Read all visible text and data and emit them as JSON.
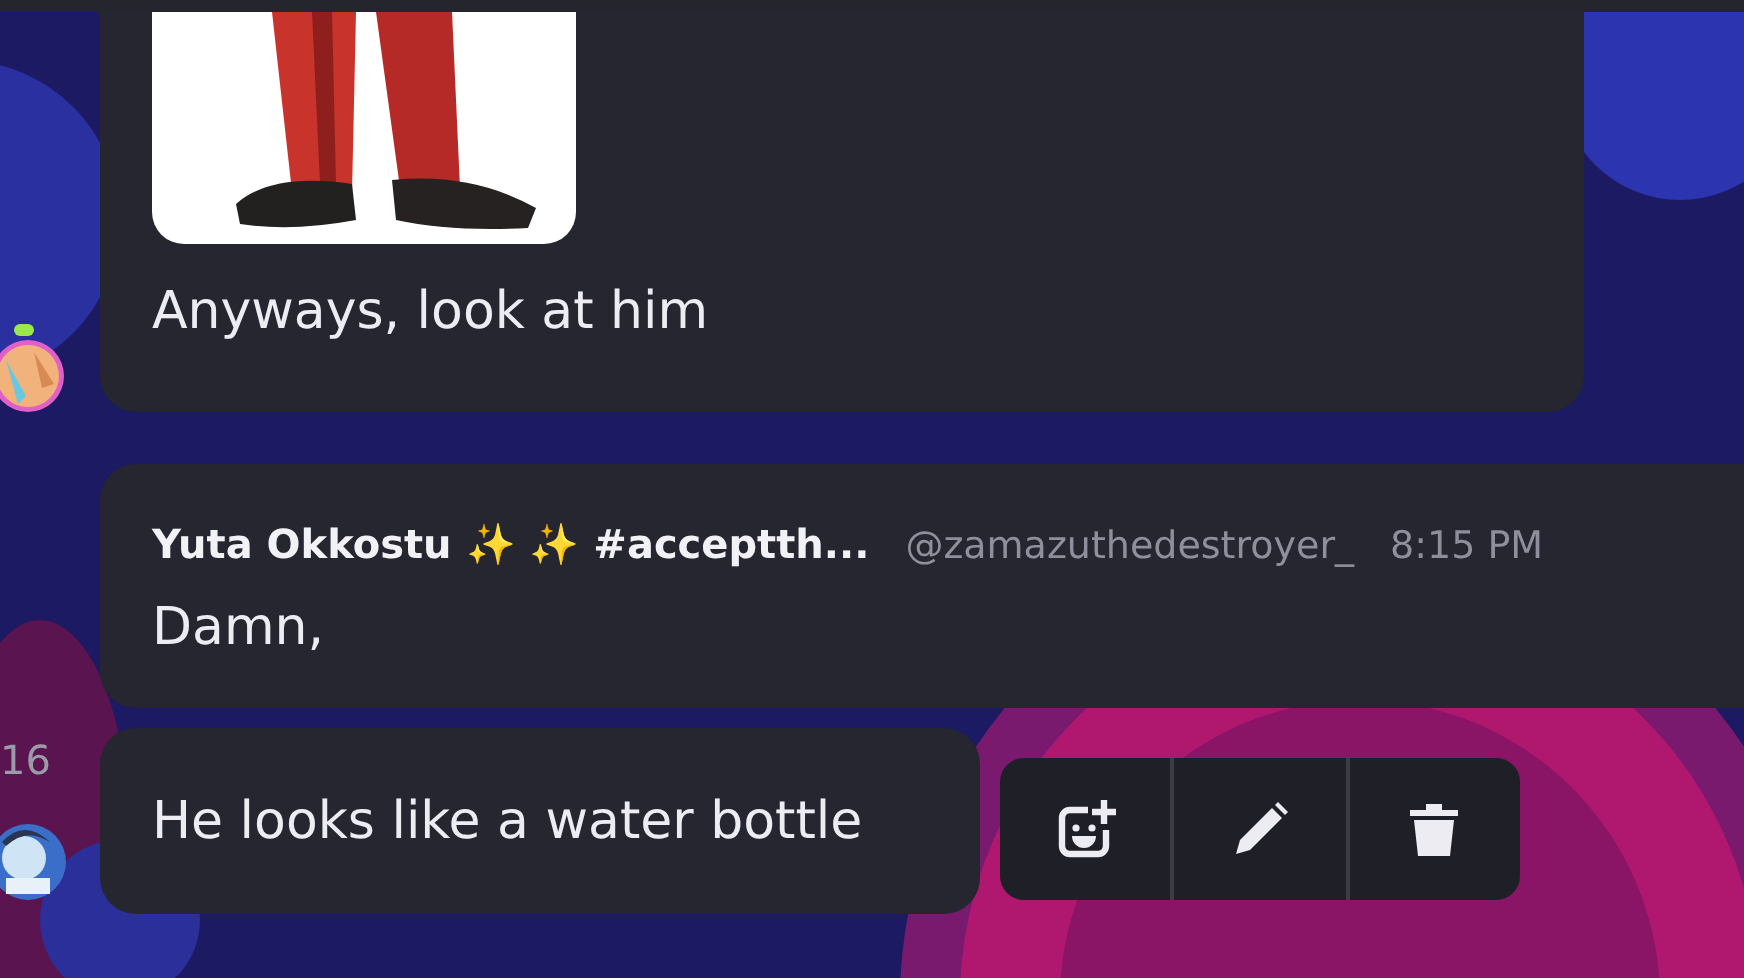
{
  "messages": [
    {
      "kind": "picture",
      "text": "Anyways, look at him"
    },
    {
      "kind": "header",
      "author": "Yuta Okkostu ✨ ✨ #acceptth...",
      "handle": "@zamazuthedestroyer_",
      "time": "8:15 PM",
      "text": "Damn,"
    },
    {
      "kind": "plain",
      "side_time": "16",
      "text": "He looks like a water bottle"
    }
  ],
  "message_actions": [
    {
      "kind": "react"
    },
    {
      "kind": "edit"
    },
    {
      "kind": "delete"
    }
  ]
}
